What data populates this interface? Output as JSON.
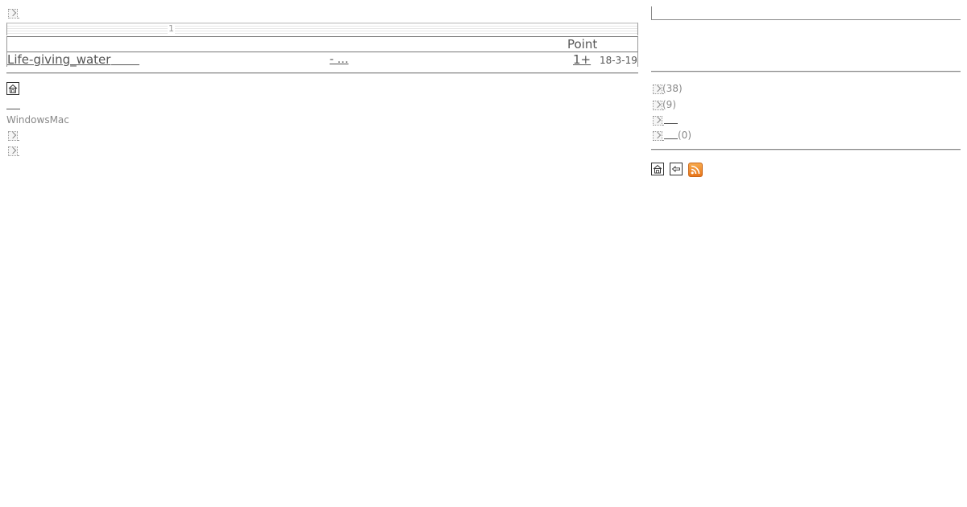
{
  "main": {
    "pager": {
      "current_page": "1"
    },
    "table": {
      "header": {
        "point_label": "Point"
      },
      "rows": [
        {
          "topic": "Life-giving_water",
          "reply": "- …",
          "point": "1+",
          "date": "18-3-19"
        }
      ]
    },
    "os_label": "WindowsMac"
  },
  "sidebar": {
    "items": [
      {
        "count": "(38)"
      },
      {
        "count": "(9)"
      },
      {
        "count": ""
      },
      {
        "count": "(0)"
      }
    ]
  },
  "icons": {
    "top": "broken-image-icon",
    "home": "home-icon",
    "back": "back-icon",
    "rss": "rss-icon"
  },
  "colors": {
    "rss": "#e8751a",
    "text": "#555555",
    "muted": "#888888"
  }
}
